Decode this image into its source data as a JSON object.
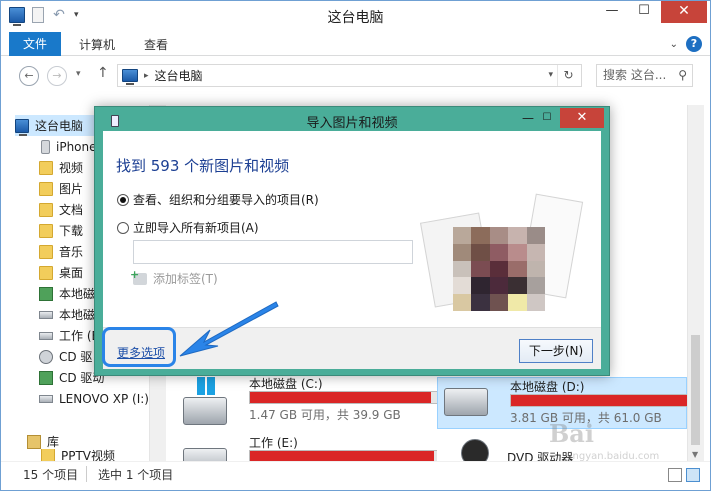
{
  "titlebar": {
    "title": "这台电脑"
  },
  "ribbon": {
    "tabs": [
      "文件",
      "计算机",
      "查看"
    ]
  },
  "address": {
    "path": "这台电脑",
    "search_placeholder": "搜索 这台..."
  },
  "nav": {
    "items": [
      {
        "label": "这台电脑",
        "icon": "pc-icon"
      },
      {
        "label": "iPhone",
        "icon": "phone-icon"
      },
      {
        "label": "视频",
        "icon": "folder-icon"
      },
      {
        "label": "图片",
        "icon": "folder-icon"
      },
      {
        "label": "文档",
        "icon": "folder-icon"
      },
      {
        "label": "下载",
        "icon": "folder-icon"
      },
      {
        "label": "音乐",
        "icon": "folder-icon"
      },
      {
        "label": "桌面",
        "icon": "folder-icon"
      },
      {
        "label": "本地磁",
        "icon": "drive-icon"
      },
      {
        "label": "本地磁",
        "icon": "drive-icon"
      },
      {
        "label": "工作 (E",
        "icon": "drive-icon"
      },
      {
        "label": "CD 驱",
        "icon": "disc-icon"
      },
      {
        "label": "CD 驱动",
        "icon": "disc-icon"
      },
      {
        "label": "LENOVO XP (I:)",
        "icon": "drive-icon"
      },
      {
        "label": "库",
        "icon": "library-icon"
      },
      {
        "label": "PPTV视频",
        "icon": "folder-icon"
      }
    ]
  },
  "drives": [
    {
      "name": "本地磁盘 (C:)",
      "info": "1.47 GB 可用，共 39.9 GB",
      "used": 0.963
    },
    {
      "name": "本地磁盘 (D:)",
      "info": "3.81 GB 可用，共 61.0 GB",
      "used": 0.938
    },
    {
      "name": "工作 (E:)",
      "info": "",
      "used": 0.98
    },
    {
      "name": "DVD 驱动器",
      "info": "",
      "used": 0
    }
  ],
  "status": {
    "count": "15 个项目",
    "selected": "选中 1 个项目"
  },
  "watermark": {
    "main": "Bai",
    "sub": "jingyan.baidu.com"
  },
  "dialog": {
    "title": "导入图片和视频",
    "found": "找到 593 个新图片和视频",
    "option1": "查看、组织和分组要导入的项目(R)",
    "option2": "立即导入所有新项目(A)",
    "add_tag": "添加标签(T)",
    "more_options": "更多选项",
    "next": "下一步(N)"
  },
  "colors": {
    "accent": "#1979ca",
    "dialog_frame": "#4aad99",
    "close_red": "#c7443a",
    "bar_red": "#da2626",
    "highlight_blue": "#2a84e8"
  }
}
